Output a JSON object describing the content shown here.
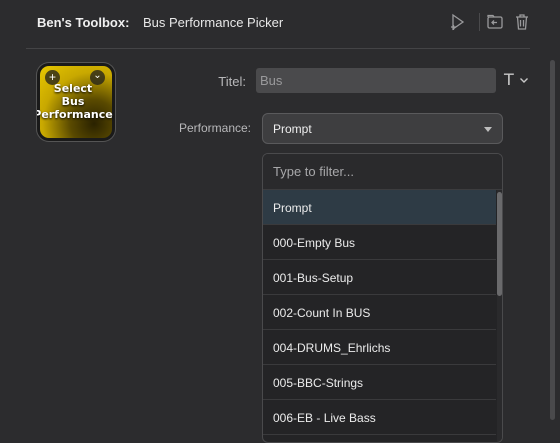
{
  "header": {
    "brand": "Ben's Toolbox:",
    "plugin_name": "Bus Performance Picker",
    "icons": [
      "play-test-icon",
      "import-icon",
      "trash-icon"
    ]
  },
  "thumbnail": {
    "text": "Select\nBus\nPerformance",
    "add_symbol": "+",
    "menu_symbol": "⌄"
  },
  "form": {
    "title_label": "Titel:",
    "title_value": "Bus",
    "title_format_symbol": "T",
    "performance_label": "Performance:",
    "performance_value": "Prompt"
  },
  "dropdown": {
    "filter_placeholder": "Type to filter...",
    "options": [
      "Prompt",
      "000-Empty Bus",
      "001-Bus-Setup",
      "002-Count In BUS",
      "004-DRUMS_Ehrlichs",
      "005-BBC-Strings",
      "006-EB - Live Bass"
    ],
    "selected_index": 0
  },
  "colors": {
    "background": "#2c2c2e",
    "highlight": "#2e3b45",
    "thumbnail_yellow": "#e8c800"
  }
}
